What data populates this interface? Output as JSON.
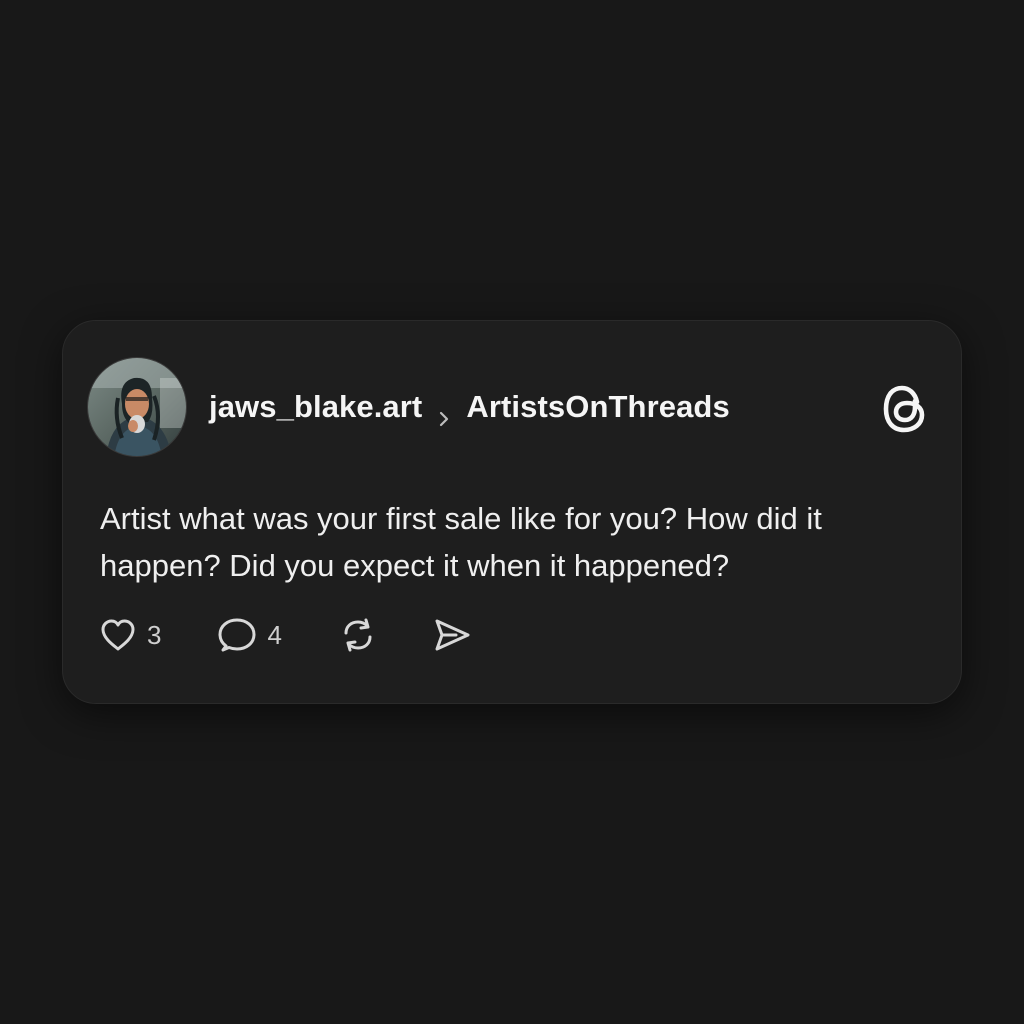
{
  "post": {
    "author": "jaws_blake.art",
    "community": "ArtistsOnThreads",
    "text": "Artist what was your first sale like for you? How did it happen? Did you expect it when it happened?",
    "likes": "3",
    "replies": "4"
  },
  "icons": {
    "avatar": "user-avatar",
    "separator": "chevron-right-icon",
    "logo": "threads-logo-icon",
    "like": "heart-icon",
    "reply": "speech-bubble-icon",
    "repost": "repost-icon",
    "share": "send-icon"
  },
  "colors": {
    "background": "#181818",
    "card": "#1e1e1e",
    "text": "#f3f3f3",
    "muted": "#cfcfcf"
  }
}
